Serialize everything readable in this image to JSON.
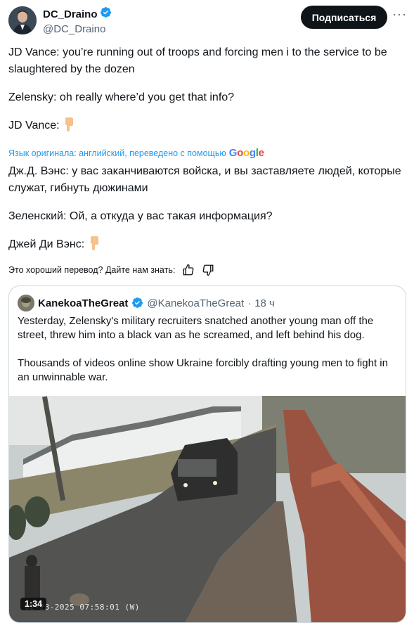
{
  "author": {
    "display_name": "DC_Draino",
    "handle": "@DC_Draino",
    "verified_icon": "verified-badge-icon",
    "subscribe_label": "Подписаться",
    "more_label": "···"
  },
  "tweet": {
    "original": {
      "line1": "JD Vance: you’re running out of troops and forcing men i to the service to be slaughtered by the dozen",
      "line2": "Zelensky: oh really where’d you get that info?",
      "line3": "JD Vance:"
    },
    "translation_note": "Язык оригинала: английский, переведено с помощью",
    "translation_provider": "Google",
    "translated": {
      "line1": "Дж.Д. Вэнс: у вас заканчиваются войска, и вы заставляете людей, которые служат, гибнуть дюжинами",
      "line2": "Зеленский: Ой, а откуда у вас такая информация?",
      "line3": "Джей Ди Вэнс:"
    },
    "feedback_prompt": "Это хороший перевод? Дайте нам знать:"
  },
  "quote": {
    "display_name": "KanekoaTheGreat",
    "handle": "@KanekoaTheGreat",
    "separator": "·",
    "time": "18 ч",
    "text1": "Yesterday, Zelensky's military recruiters snatched another young man off the street, threw him into a black van as he screamed, and left behind his dog.",
    "text2": "Thousands of videos online show Ukraine forcibly drafting young men to fight in an unwinnable war.",
    "video": {
      "duration": "1:34",
      "timestamp": "02-28-2025 07:58:01  (W)"
    }
  },
  "colors": {
    "accent": "#1d9bf0",
    "text": "#0f1419",
    "muted": "#536471",
    "border": "#cfd9de"
  }
}
